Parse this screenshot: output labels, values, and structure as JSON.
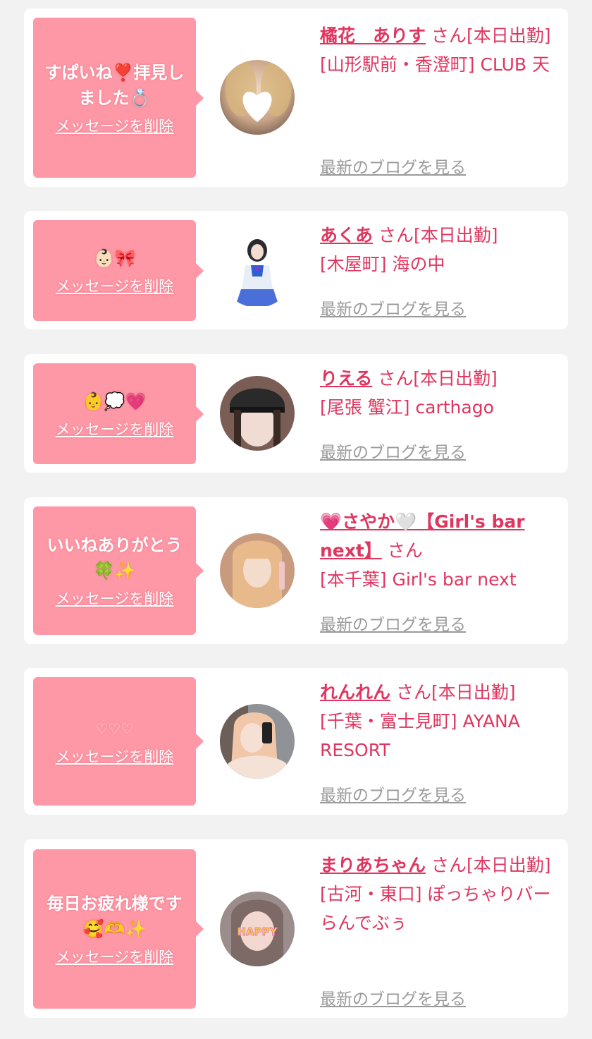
{
  "cards": [
    {
      "message": "すぱいね❣️拝見しました💍",
      "delete_label": "メッセージを削除",
      "name": "橘花　ありす",
      "suffix": " さん[本日出勤]",
      "shop": "[山形駅前・香澄町] CLUB 天",
      "blog_label": "最新のブログを見る"
    },
    {
      "message": "👶🏻🎀",
      "delete_label": "メッセージを削除",
      "name": "あくあ",
      "suffix": " さん[本日出勤]",
      "shop": "[木屋町] 海の中",
      "blog_label": "最新のブログを見る"
    },
    {
      "message": "👶💭💗",
      "delete_label": "メッセージを削除",
      "name": "りえる",
      "suffix": " さん[本日出勤]",
      "shop": "[尾張 蟹江] carthago",
      "blog_label": "最新のブログを見る"
    },
    {
      "message": "いいねありがとう🍀✨",
      "delete_label": "メッセージを削除",
      "name": "💗さやか🤍【Girl's bar next】",
      "suffix": " さん",
      "shop": "[本千葉] Girl's bar next",
      "blog_label": "最新のブログを見る"
    },
    {
      "message": "♡♡♡",
      "delete_label": "メッセージを削除",
      "name": "れんれん",
      "suffix": " さん[本日出勤]",
      "shop": "[千葉・富士見町] AYANA RESORT",
      "blog_label": "最新のブログを見る"
    },
    {
      "message": "毎日お疲れ様です🥰🫶✨",
      "delete_label": "メッセージを削除",
      "name": "まりあちゃん",
      "suffix": " さん[本日出勤]",
      "shop": "[古河・東口] ぽっちゃりバー らんでぶぅ",
      "blog_label": "最新のブログを見る"
    }
  ],
  "avatar_text": {
    "happy": "HAPPY"
  },
  "colors": {
    "page_bg": "#f2f2f2",
    "bubble": "#ff98a6",
    "accent": "#e0355f",
    "link_gray": "#9a9a9a"
  }
}
